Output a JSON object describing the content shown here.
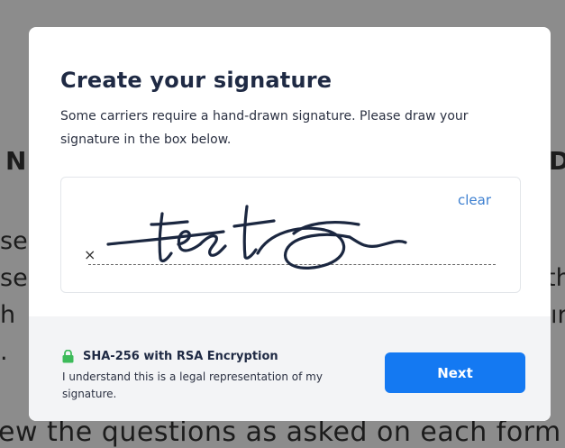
{
  "background_page": {
    "heading_left": "N",
    "heading_right": "D",
    "lines_left": [
      "se",
      "se",
      "h",
      "."
    ],
    "lines_right": [
      "",
      "th",
      "ır",
      ""
    ],
    "bottom_line": "ew the questions as asked on each form"
  },
  "modal": {
    "title": "Create your signature",
    "description": "Some carriers require a hand-drawn signature. Please draw your signature in the box below.",
    "signature_box": {
      "clear_label": "clear",
      "x_mark": "×",
      "signature_text": "test"
    },
    "footer": {
      "security_title": "SHA-256 with RSA Encryption",
      "security_desc": "I understand this is a legal representation of my signature.",
      "next_label": "Next"
    }
  },
  "colors": {
    "overlay": "#8c8c8c",
    "primary_button": "#1479f2",
    "link": "#3c7fd0",
    "lock": "#3dbb5a",
    "ink": "#1b2740"
  }
}
